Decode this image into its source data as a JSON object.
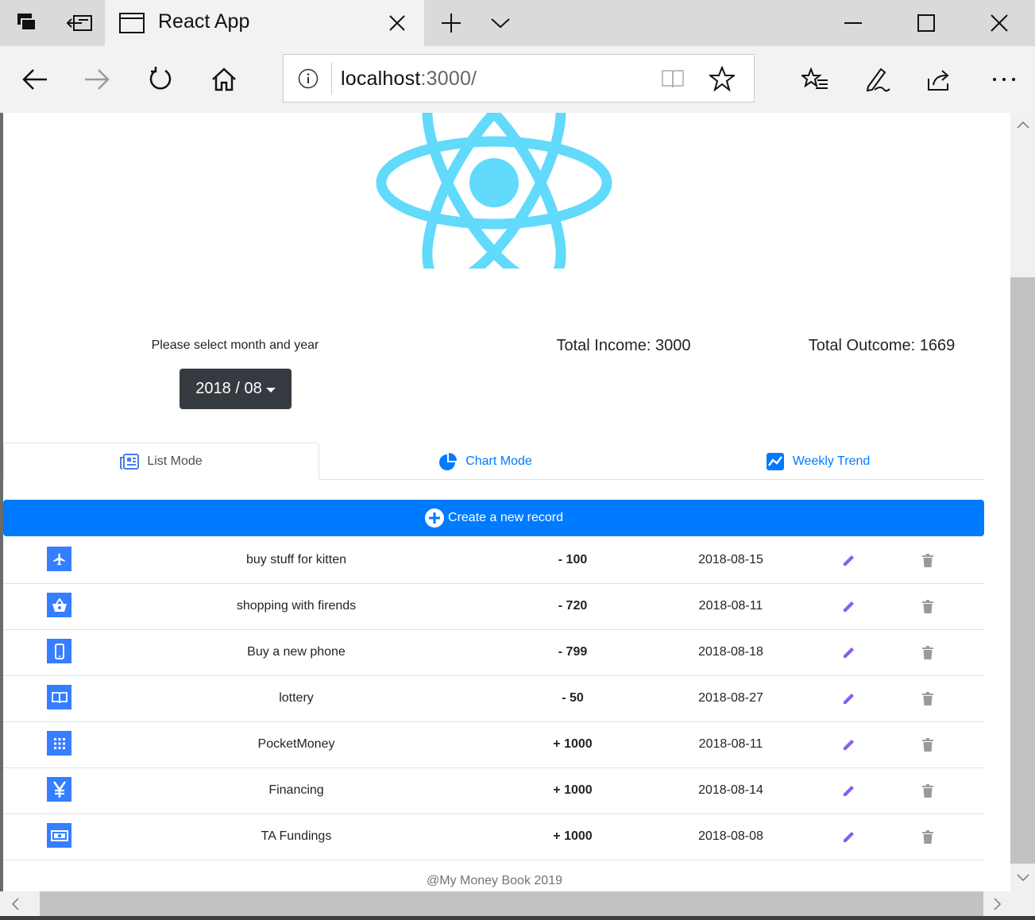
{
  "browser": {
    "tab_title": "React App",
    "url_host": "localhost",
    "url_port": ":3000/"
  },
  "header": {
    "select_label": "Please select month and year",
    "month_value": "2018 / 08",
    "total_income": "Total Income: 3000",
    "total_outcome": "Total Outcome: 1669"
  },
  "tabs": {
    "list": "List Mode",
    "chart": "Chart Mode",
    "weekly": "Weekly Trend"
  },
  "create_label": "Create a new record",
  "records": [
    {
      "icon": "airplane-icon",
      "title": "buy stuff for kitten",
      "amount": "- 100",
      "date": "2018-08-15"
    },
    {
      "icon": "basket-icon",
      "title": "shopping with firends",
      "amount": "- 720",
      "date": "2018-08-11"
    },
    {
      "icon": "phone-icon",
      "title": "Buy a new phone",
      "amount": "- 799",
      "date": "2018-08-18"
    },
    {
      "icon": "book-icon",
      "title": "lottery",
      "amount": "- 50",
      "date": "2018-08-27"
    },
    {
      "icon": "grid-icon",
      "title": "PocketMoney",
      "amount": "+ 1000",
      "date": "2018-08-11"
    },
    {
      "icon": "yen-icon",
      "title": "Financing",
      "amount": "+ 1000",
      "date": "2018-08-14"
    },
    {
      "icon": "cash-icon",
      "title": "TA Fundings",
      "amount": "+ 1000",
      "date": "2018-08-08"
    }
  ],
  "footer": "@My Money Book 2019",
  "colors": {
    "primary": "#007bff",
    "icon_bg": "#347eff",
    "edit": "#8a5cf5",
    "delete": "#9a9a9a",
    "react_logo": "#61dafb",
    "dark_button": "#343a40"
  }
}
